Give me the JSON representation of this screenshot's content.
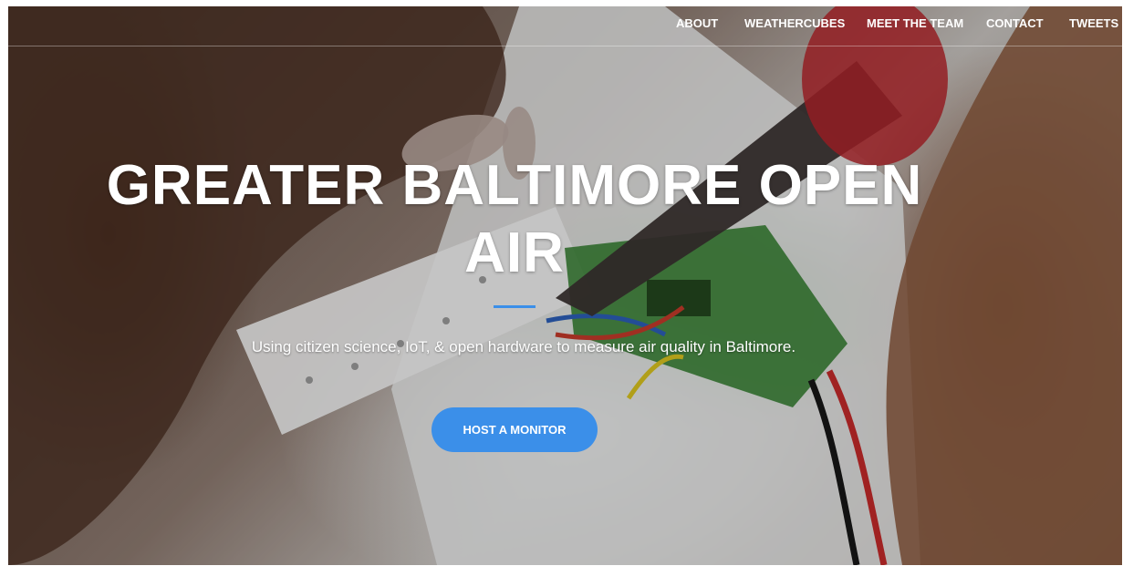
{
  "nav": {
    "items": [
      {
        "label": "ABOUT"
      },
      {
        "label": "WEATHERCUBES"
      },
      {
        "label": "MEET THE TEAM"
      },
      {
        "label": "CONTACT"
      },
      {
        "label": "TWEETS"
      }
    ]
  },
  "hero": {
    "title": "GREATER BALTIMORE OPEN AIR",
    "subtitle": "Using citizen science, IoT, & open hardware to measure air quality in Baltimore.",
    "cta_label": "HOST A MONITOR",
    "accent_color": "#3b8fe9"
  }
}
